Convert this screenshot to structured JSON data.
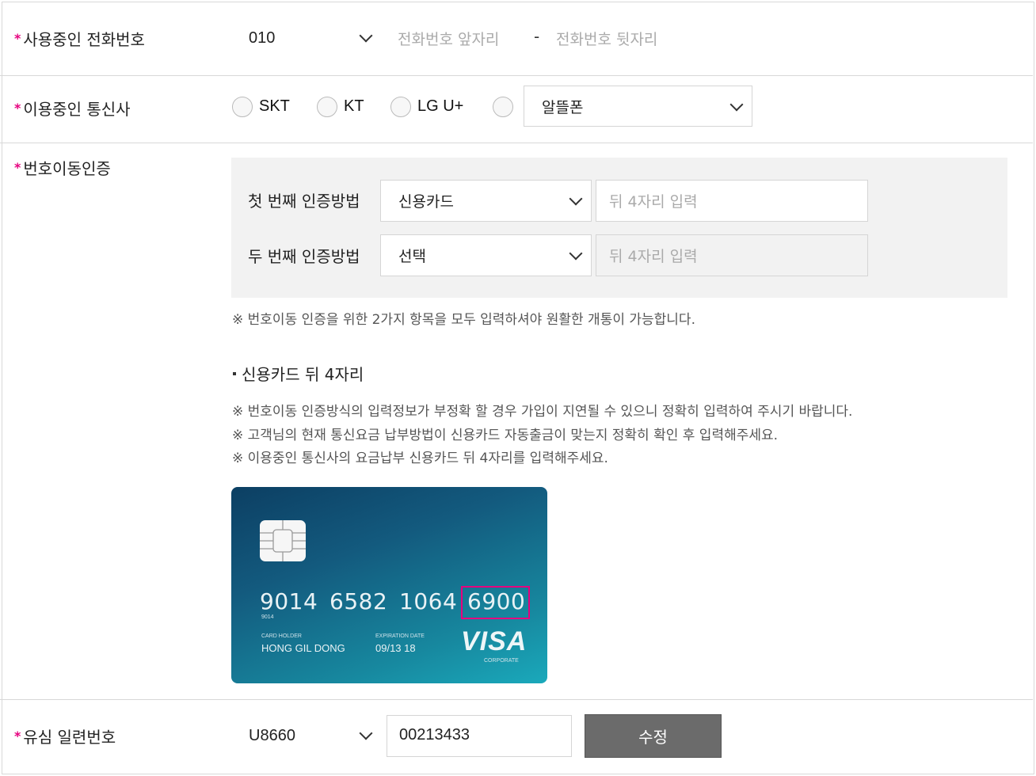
{
  "phone": {
    "label": "사용중인 전화번호",
    "prefix": "010",
    "front_placeholder": "전화번호 앞자리",
    "dash": "-",
    "back_placeholder": "전화번호 뒷자리"
  },
  "carrier": {
    "label": "이용중인 통신사",
    "options": [
      "SKT",
      "KT",
      "LG U+"
    ],
    "mvno_select": "알뜰폰"
  },
  "port_auth": {
    "label": "번호이동인증",
    "first_label": "첫 번째 인증방법",
    "first_select": "신용카드",
    "first_placeholder": "뒤 4자리 입력",
    "second_label": "두 번째 인증방법",
    "second_select": "선택",
    "second_placeholder": "뒤 4자리 입력",
    "note": "※ 번호이동 인증을 위한 2가지 항목을 모두 입력하셔야 원활한 개통이 가능합니다.",
    "card_section_title": "신용카드 뒤 4자리",
    "card_notes": [
      "※  번호이동 인증방식의 입력정보가 부정확 할 경우 가입이 지연될 수 있으니 정확히 입력하여 주시기 바랍니다.",
      "※  고객님의 현재 통신요금 납부방법이 신용카드 자동출금이 맞는지 정확히 확인 후 입력해주세요.",
      "※  이용중인 통신사의 요금납부 신용카드 뒤 4자리를 입력해주세요."
    ]
  },
  "card": {
    "groups": [
      "9014",
      "6582",
      "1064",
      "6900"
    ],
    "small_num": "9014",
    "holder_label": "CARD HOLDER",
    "holder_name": "HONG GIL DONG",
    "exp_label": "EXPIRATION DATE",
    "exp_value": "09/13 18",
    "brand": "VISA",
    "brand_sub": "CORPORATE"
  },
  "usim": {
    "label": "유심 일련번호",
    "select": "U8660",
    "value": "00213433",
    "button": "수정"
  },
  "colors": {
    "accent": "#e6007e",
    "button": "#6b6b6b"
  }
}
